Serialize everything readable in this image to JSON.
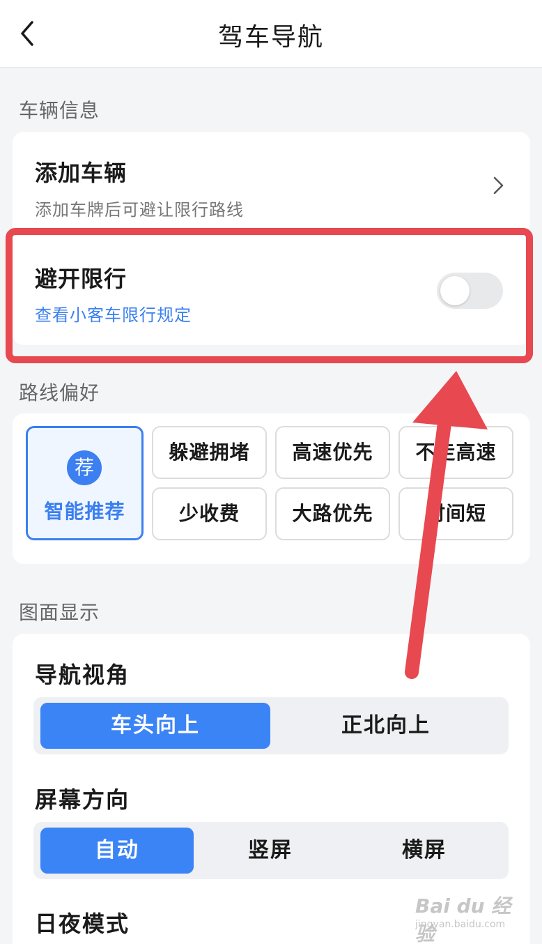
{
  "header": {
    "title": "驾车导航"
  },
  "vehicle_section": {
    "title": "车辆信息",
    "add_vehicle": {
      "label": "添加车辆",
      "sub": "添加车牌后可避让限行路线"
    },
    "avoid_restriction": {
      "label": "避开限行",
      "link": "查看小客车限行规定",
      "enabled": false
    }
  },
  "route_section": {
    "title": "路线偏好",
    "recommended": {
      "badge": "荐",
      "label": "智能推荐",
      "selected": true
    },
    "options": [
      "躲避拥堵",
      "高速优先",
      "不走高速",
      "少收费",
      "大路优先",
      "时间短"
    ]
  },
  "display_section": {
    "title": "图面显示",
    "nav_view": {
      "label": "导航视角",
      "options": [
        "车头向上",
        "正北向上"
      ],
      "selected": "车头向上"
    },
    "orientation": {
      "label": "屏幕方向",
      "options": [
        "自动",
        "竖屏",
        "横屏"
      ],
      "selected": "自动"
    },
    "day_night": {
      "label": "日夜模式"
    }
  },
  "watermark": {
    "main": "Bai du 经验",
    "sub": "jingyan.baidu.com"
  },
  "colors": {
    "accent": "#3b7ff0",
    "highlight": "#e84850"
  }
}
